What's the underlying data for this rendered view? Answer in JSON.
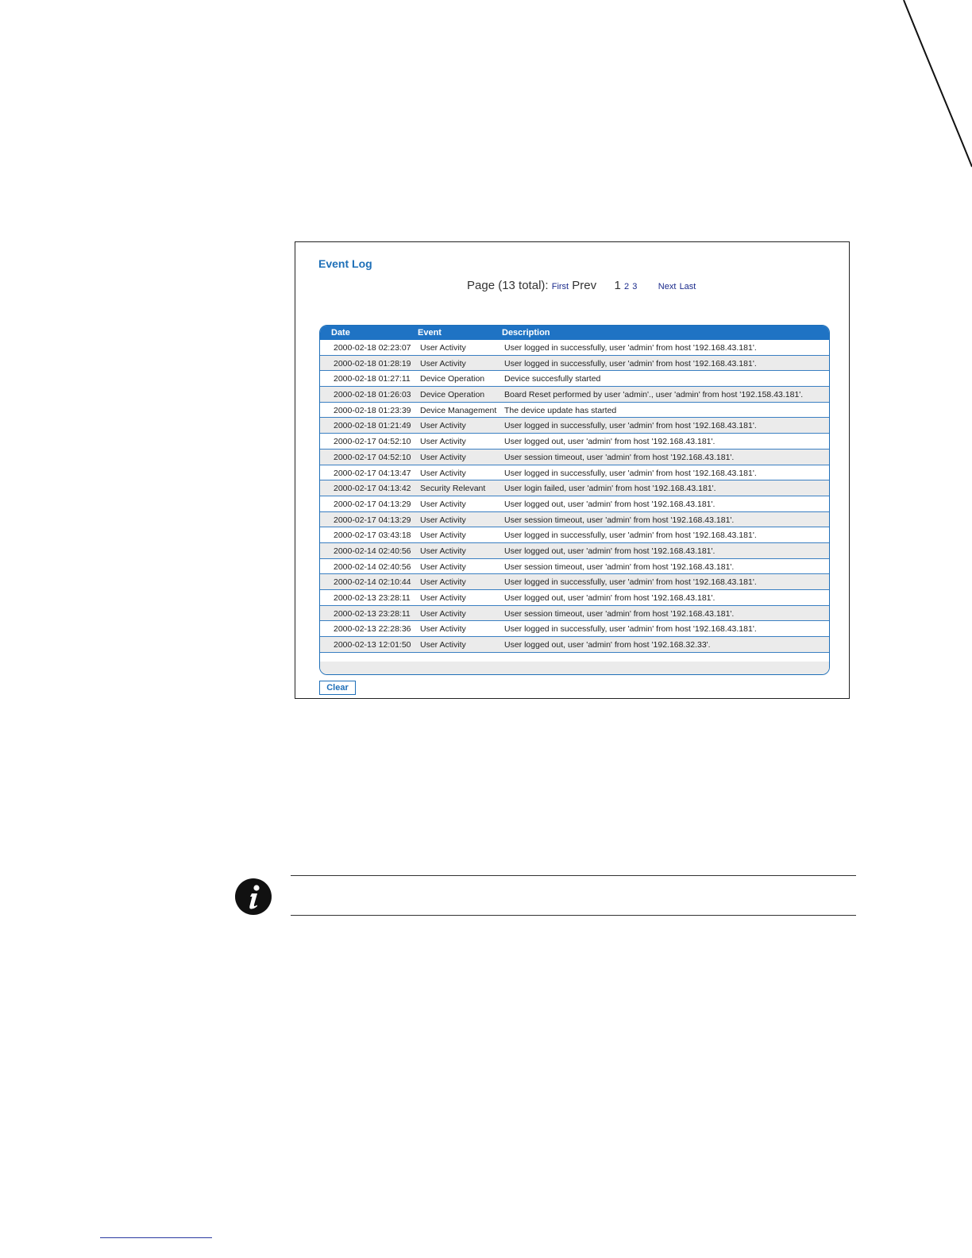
{
  "event_log": {
    "title": "Event Log",
    "pager": {
      "label": "Page (13 total):",
      "first": "First",
      "prev": "Prev",
      "current": "1",
      "pages": [
        "2",
        "3"
      ],
      "next": "Next",
      "last": "Last"
    },
    "columns": [
      "Date",
      "Event",
      "Description"
    ],
    "rows": [
      [
        "2000-02-18 02:23:07",
        "User Activity",
        "User logged in successfully, user 'admin' from host '192.168.43.181'."
      ],
      [
        "2000-02-18 01:28:19",
        "User Activity",
        "User logged in successfully, user 'admin' from host '192.168.43.181'."
      ],
      [
        "2000-02-18 01:27:11",
        "Device Operation",
        "Device succesfully started"
      ],
      [
        "2000-02-18 01:26:03",
        "Device Operation",
        "Board Reset performed by user 'admin'., user 'admin' from host '192.158.43.181'."
      ],
      [
        "2000-02-18 01:23:39",
        "Device Management",
        "The device update has started"
      ],
      [
        "2000-02-18 01:21:49",
        "User Activity",
        "User logged in successfully, user 'admin' from host '192.168.43.181'."
      ],
      [
        "2000-02-17 04:52:10",
        "User Activity",
        "User logged out, user 'admin' from host '192.168.43.181'."
      ],
      [
        "2000-02-17 04:52:10",
        "User Activity",
        "User session timeout, user 'admin' from host '192.168.43.181'."
      ],
      [
        "2000-02-17 04:13:47",
        "User Activity",
        "User logged in successfully, user 'admin' from host '192.168.43.181'."
      ],
      [
        "2000-02-17 04:13:42",
        "Security Relevant",
        "User login failed, user 'admin' from host '192.168.43.181'."
      ],
      [
        "2000-02-17 04:13:29",
        "User Activity",
        "User logged out, user 'admin' from host '192.168.43.181'."
      ],
      [
        "2000-02-17 04:13:29",
        "User Activity",
        "User session timeout, user 'admin' from host '192.168.43.181'."
      ],
      [
        "2000-02-17 03:43:18",
        "User Activity",
        "User logged in successfully, user 'admin' from host '192.168.43.181'."
      ],
      [
        "2000-02-14 02:40:56",
        "User Activity",
        "User logged out, user 'admin' from host '192.168.43.181'."
      ],
      [
        "2000-02-14 02:40:56",
        "User Activity",
        "User session timeout, user 'admin' from host '192.168.43.181'."
      ],
      [
        "2000-02-14 02:10:44",
        "User Activity",
        "User logged in successfully, user 'admin' from host '192.168.43.181'."
      ],
      [
        "2000-02-13 23:28:11",
        "User Activity",
        "User logged out, user 'admin' from host '192.168.43.181'."
      ],
      [
        "2000-02-13 23:28:11",
        "User Activity",
        "User session timeout, user 'admin' from host '192.168.43.181'."
      ],
      [
        "2000-02-13 22:28:36",
        "User Activity",
        "User logged in successfully, user 'admin' from host '192.168.43.181'."
      ],
      [
        "2000-02-13 12:01:50",
        "User Activity",
        "User logged out, user 'admin' from host '192.168.32.33'."
      ]
    ],
    "clear_label": "Clear"
  },
  "icons": {
    "note": "info-icon"
  },
  "colors": {
    "accent": "#1f73c4",
    "title": "#1f70b8",
    "row_alt": "#ebebeb",
    "link": "#1a2a8c"
  }
}
